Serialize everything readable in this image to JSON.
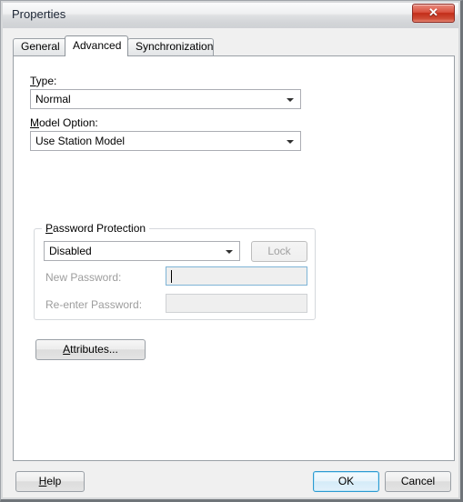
{
  "window": {
    "title": "Properties",
    "close_label": "✕",
    "close_icon": "close-icon"
  },
  "tabs": [
    {
      "label": "General",
      "active": false
    },
    {
      "label": "Advanced",
      "active": true
    },
    {
      "label": "Synchronization",
      "active": false
    }
  ],
  "advanced": {
    "type": {
      "label_pre": "",
      "label_accel": "T",
      "label_post": "ype:",
      "value": "Normal"
    },
    "model_option": {
      "label_pre": "",
      "label_accel": "M",
      "label_post": "odel Option:",
      "value": "Use Station Model"
    },
    "password_protection": {
      "group_accel": "P",
      "group_post": "assword Protection",
      "state_value": "Disabled",
      "lock_label": "Lock",
      "lock_enabled": false,
      "new_password_label": "New Password:",
      "new_password_value": "",
      "reenter_password_label": "Re-enter Password:",
      "reenter_password_value": ""
    },
    "attributes": {
      "label_accel": "A",
      "label_post": "ttributes..."
    }
  },
  "footer": {
    "help_accel": "H",
    "help_post": "elp",
    "ok_label": "OK",
    "cancel_label": "Cancel"
  },
  "colors": {
    "accent": "#2c9ad1",
    "close_red": "#c22d19",
    "panel_bg": "#ffffff",
    "dialog_bg": "#f0f0f0",
    "disabled_text": "#9d9d9d"
  }
}
